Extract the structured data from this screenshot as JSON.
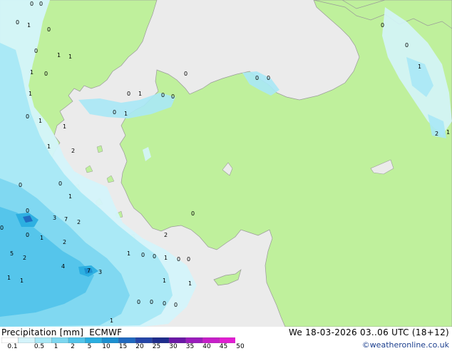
{
  "title": {
    "label": "Precipitation [mm]",
    "model": "ECMWF"
  },
  "datetime": "We 18-03-2026 03..06 UTC (18+12)",
  "credit": "©weatheronline.co.uk",
  "colors": {
    "sea": "#ebebeb",
    "land": "#bff09c",
    "coast": "#9a9a9a",
    "precip_levels": [
      "#ffffff",
      "#d4f4fb",
      "#a8e8f6",
      "#7dd7f0",
      "#52c4ea",
      "#2aaee0",
      "#1c8fd0",
      "#2069c0",
      "#2545a8",
      "#1e2c8c",
      "#6a18a6",
      "#9a1cbc",
      "#c61ec8",
      "#e21ed2",
      "#f51fd8"
    ]
  },
  "legend": {
    "ticks": [
      "0.1",
      "0.5",
      "1",
      "2",
      "5",
      "10",
      "15",
      "20",
      "25",
      "30",
      "35",
      "40",
      "45",
      "50"
    ]
  },
  "map_values": [
    "0",
    "1",
    "2",
    "3",
    "4",
    "5",
    "7"
  ]
}
